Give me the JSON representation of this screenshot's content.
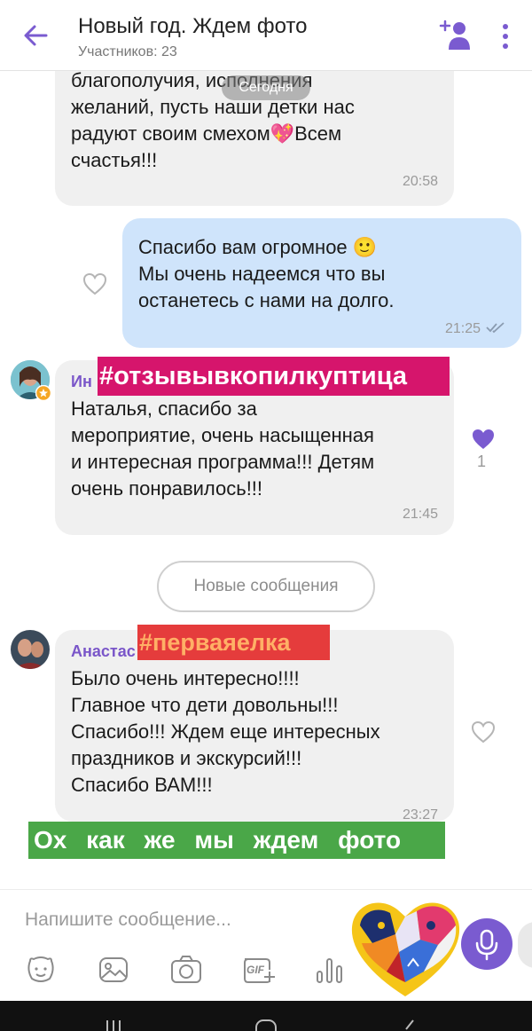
{
  "header": {
    "title": "Новый год. Ждем фото",
    "subtitle": "Участников: 23",
    "icons": [
      "arrow-left-icon",
      "add-participant-icon",
      "more-vertical-icon"
    ],
    "accent": "#7a5bd0"
  },
  "chat": {
    "date_separator": "Сегодня",
    "messages": [
      {
        "direction": "in",
        "text": "благополучия, исполнения\nжеланий, пусть наши детки нас\nрадуют своим смехом💖Всем\nсчастья!!!",
        "time": "20:58"
      },
      {
        "direction": "out",
        "text": "Спасибо вам огромное 🙂\nМы очень надеемся что вы\nостанетесь с нами на долго.",
        "time": "21:25"
      },
      {
        "direction": "in",
        "sender": "Ин",
        "tag": "#отзывывкопилкуптица",
        "text": "Наталья, спасибо за\nмероприятие, очень насыщенная\nи интересная программа!!! Детям\nочень понравилось!!!",
        "time": "21:45",
        "likes": "1"
      },
      {
        "direction": "in",
        "sender": "Анастас",
        "tag": "#перваяелка",
        "text": "Было очень интересно!!!!\nГлавное что дети довольны!!!\nСпасибо!!! Ждем еще интересных\nпраздников и экскурсий!!!\nСпасибо ВАМ!!!",
        "time": "23:27"
      }
    ],
    "new_messages_label": "Новые сообщения",
    "caption": "Ох как же мы ждем фото",
    "colors": {
      "incoming_bubble": "#f0f0f0",
      "outgoing_bubble": "#cfe4fb",
      "tag_pink": "#d6156c",
      "tag_red": "#e53c3c",
      "caption_green": "#4aa748",
      "liked_heart": "#7a5bd0"
    }
  },
  "composer": {
    "placeholder": "Напишите сообщение...",
    "tools": [
      "sticker-icon",
      "gallery-icon",
      "camera-icon",
      "gif-icon",
      "voice-wave-icon"
    ],
    "gif_label": "GIF"
  }
}
